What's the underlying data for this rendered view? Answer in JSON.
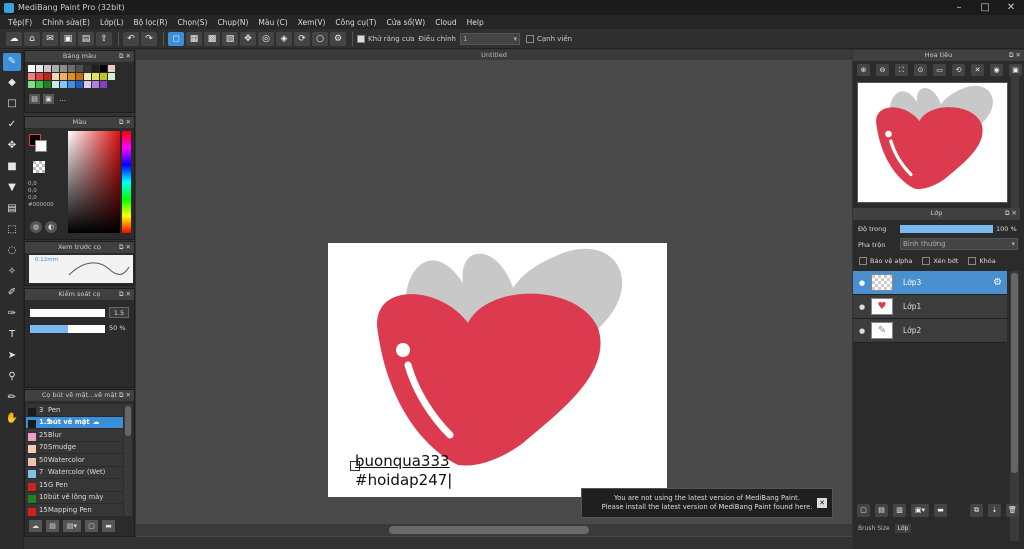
{
  "title": "MediBang Paint Pro (32bit)",
  "menu": [
    "Tệp(F)",
    "Chỉnh sửa(E)",
    "Lớp(L)",
    "Bộ lọc(R)",
    "Chọn(S)",
    "Chụp(N)",
    "Màu (C)",
    "Xem(V)",
    "Công cụ(T)",
    "Cửa sổ(W)",
    "Cloud",
    "Help"
  ],
  "toolbar": {
    "antialias_label": "Khử răng cưa",
    "adjust_label": "Điều chỉnh",
    "adjust_value": "1",
    "edge_label": "Cạnh viền"
  },
  "panels": {
    "palette_title": "Bảng màu",
    "color_title": "Màu",
    "color_values": [
      "0,0",
      "0,0",
      "0,0"
    ],
    "color_hex": "#000000",
    "brush_preview_title": "Xem trước cọ",
    "brush_preview_size": "0.12mm",
    "brush_control_title": "Kiểm soát cọ",
    "brush_size_value": "1.5",
    "opacity_value": "50 %",
    "brush_list_title": "Cọ bút vẽ mặt...vẽ mặt"
  },
  "palette_colors": [
    "#ffffff",
    "#e6e6e6",
    "#c8c8c8",
    "#aaaaaa",
    "#8c8c8c",
    "#6e6e6e",
    "#505050",
    "#323232",
    "#1e1e1e",
    "#000000",
    "#f0c8c8",
    "#f08080",
    "#e04040",
    "#c02020",
    "#f0d8b0",
    "#f0b060",
    "#e09020",
    "#c07010",
    "#f0f0b0",
    "#e0e060",
    "#c0c020",
    "#d0f0d0",
    "#80e080",
    "#40c040",
    "#208020",
    "#c8e8f0",
    "#80c8f0",
    "#4090e0",
    "#2060c0",
    "#e0c8f0",
    "#b080e0",
    "#8040c0"
  ],
  "brushes": [
    {
      "size": "3",
      "name": "Pen",
      "color": "#1a1a1a",
      "selected": false
    },
    {
      "size": "1.5",
      "name": "bút vẽ mặt",
      "color": "#1a1a1a",
      "selected": true
    },
    {
      "size": "25",
      "name": "Blur",
      "color": "#f0a0c0",
      "selected": false
    },
    {
      "size": "70",
      "name": "Smudge",
      "color": "#f0d0b0",
      "selected": false
    },
    {
      "size": "50",
      "name": "Watercolor",
      "color": "#f0c0b0",
      "selected": false
    },
    {
      "size": "7",
      "name": "Watercolor (Wet)",
      "color": "#80c0f0",
      "selected": false
    },
    {
      "size": "15",
      "name": "G Pen",
      "color": "#d02020",
      "selected": false
    },
    {
      "size": "10",
      "name": "bút vẽ lông mày",
      "color": "#208020",
      "selected": false
    },
    {
      "size": "15",
      "name": "Mapping Pen",
      "color": "#d02020",
      "selected": false
    }
  ],
  "document": {
    "tab": "Untitled"
  },
  "canvas_text": {
    "line1": "buonqua333",
    "line2": "#hoidap247"
  },
  "navigator_title": "Hoa tiêu",
  "layer_panel": {
    "title": "Lớp",
    "opacity_label": "Độ trong",
    "opacity_value": "100 %",
    "opacity_fraction": 1.0,
    "blend_label": "Pha trộn",
    "blend_value": "Bình thường",
    "protect_alpha": "Bảo vệ alpha",
    "clipping": "Xén bớt",
    "lock": "Khóa",
    "layers": [
      {
        "name": "Lớp3",
        "selected": true
      },
      {
        "name": "Lớp1",
        "selected": false
      },
      {
        "name": "Lớp2",
        "selected": false
      }
    ],
    "footer_tabs": [
      "Brush Size",
      "Lớp"
    ]
  },
  "notice": {
    "line1": "You are not using the latest version of MediBang Paint.",
    "line2": "Please install the latest version of MediBang Paint found here."
  },
  "colors": {
    "accent": "#3a8fd8",
    "heart": "#dc3a4e",
    "heart_shadow": "#c8c8c8"
  }
}
